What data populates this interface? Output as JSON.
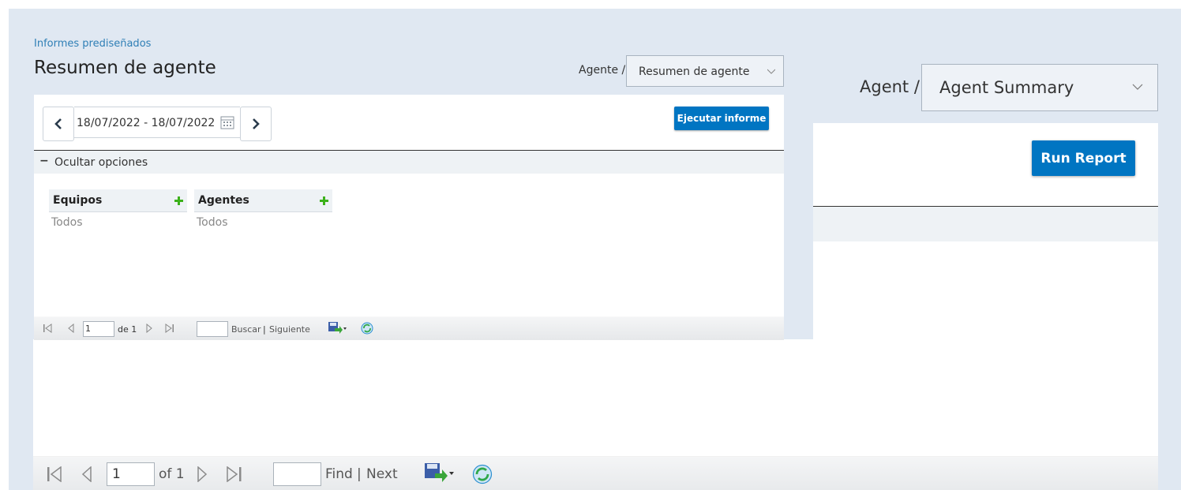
{
  "breadcrumb": "Informes prediseñados",
  "page_title": "Resumen de agente",
  "left": {
    "selector_label": "Agente /",
    "selector_value": "Resumen de agente",
    "date_range": "18/07/2022 - 18/07/2022",
    "run_label": "Ejecutar informe",
    "options_toggle": "Ocultar opciones",
    "filters": [
      {
        "name": "Equipos",
        "value": "Todos"
      },
      {
        "name": "Agentes",
        "value": "Todos"
      }
    ],
    "toolbar": {
      "page": "1",
      "of": "de 1",
      "find": "Buscar",
      "sep": "|",
      "next": "Siguiente"
    }
  },
  "right": {
    "selector_label": "Agent /",
    "selector_value": "Agent Summary",
    "run_label": "Run Report"
  },
  "bottom_toolbar": {
    "page": "1",
    "of": "of 1",
    "find": "Find",
    "sep": "|",
    "next": "Next"
  }
}
